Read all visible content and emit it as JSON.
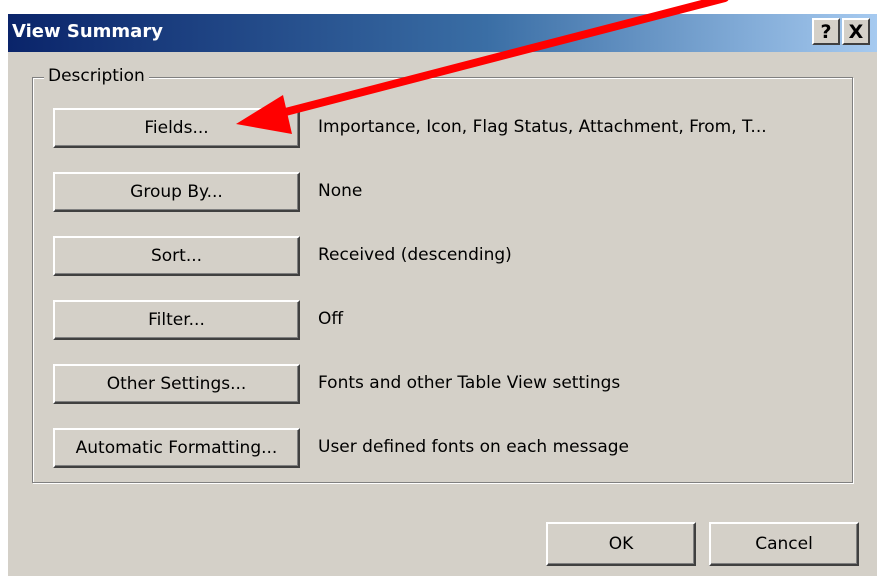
{
  "dialog": {
    "title": "View Summary",
    "help_button": "?",
    "close_button": "X"
  },
  "description_group": {
    "label": "Description",
    "rows": [
      {
        "button": "Fields...",
        "value": "Importance, Icon, Flag Status, Attachment, From, T..."
      },
      {
        "button": "Group By...",
        "value": "None"
      },
      {
        "button": "Sort...",
        "value": "Received (descending)"
      },
      {
        "button": "Filter...",
        "value": "Off"
      },
      {
        "button": "Other Settings...",
        "value": "Fonts and other Table View settings"
      },
      {
        "button": "Automatic Formatting...",
        "value": "User defined fonts on each message"
      }
    ]
  },
  "footer": {
    "ok_label": "OK",
    "cancel_label": "Cancel"
  },
  "colors": {
    "dialog_background": "#d4d0c8",
    "titlebar_start": "#0a246a",
    "titlebar_end": "#a6caf0",
    "annotation_arrow": "#ff0000"
  }
}
